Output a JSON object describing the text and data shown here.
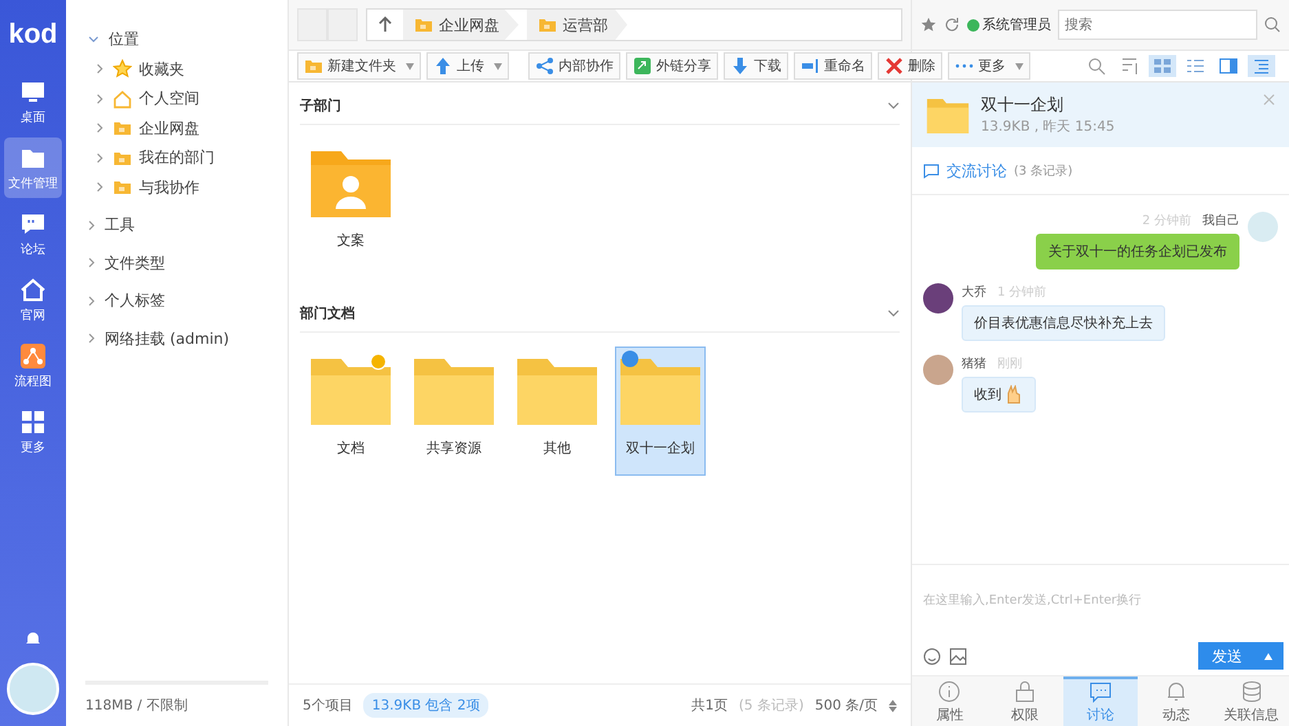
{
  "nav": {
    "logo": "kod",
    "items": [
      {
        "label": "桌面",
        "kind": "desktop",
        "selected": false
      },
      {
        "label": "文件管理",
        "kind": "folder",
        "selected": true
      },
      {
        "label": "论坛",
        "kind": "chat",
        "selected": false
      },
      {
        "label": "官网",
        "kind": "home",
        "selected": false
      },
      {
        "label": "流程图",
        "kind": "flow",
        "selected": false
      },
      {
        "label": "更多",
        "kind": "grid",
        "selected": false
      }
    ]
  },
  "tree": {
    "sections": [
      {
        "label": "位置",
        "expanded": true,
        "children": [
          {
            "label": "收藏夹",
            "kind": "star"
          },
          {
            "label": "个人空间",
            "kind": "house"
          },
          {
            "label": "企业网盘",
            "kind": "folder"
          },
          {
            "label": "我在的部门",
            "kind": "folder"
          },
          {
            "label": "与我协作",
            "kind": "folder"
          }
        ]
      },
      {
        "label": "工具",
        "expanded": false
      },
      {
        "label": "文件类型",
        "expanded": false
      },
      {
        "label": "个人标签",
        "expanded": false
      },
      {
        "label": "网络挂载 (admin)",
        "expanded": false
      }
    ],
    "storage": "118MB / 不限制"
  },
  "address": {
    "breadcrumbs": [
      "企业网盘",
      "运营部"
    ],
    "user": "系统管理员",
    "search": {
      "placeholder": "搜索"
    }
  },
  "toolbar": [
    {
      "label": "新建文件夹",
      "kind": "folder",
      "dropdown": true
    },
    {
      "label": "上传",
      "kind": "up",
      "dropdown": true
    },
    {
      "label": "内部协作",
      "kind": "share",
      "dropdown": false
    },
    {
      "label": "外链分享",
      "kind": "link",
      "dropdown": false
    },
    {
      "label": "下载",
      "kind": "down",
      "dropdown": false
    },
    {
      "label": "重命名",
      "kind": "rename",
      "dropdown": false
    },
    {
      "label": "删除",
      "kind": "delete",
      "dropdown": false
    },
    {
      "label": "更多",
      "kind": "more",
      "dropdown": true
    }
  ],
  "views": [
    {
      "kind": "zoom",
      "selected": false
    },
    {
      "kind": "sort",
      "selected": false
    },
    {
      "kind": "icons",
      "selected": true
    },
    {
      "kind": "list",
      "selected": false
    },
    {
      "kind": "split",
      "selected": false
    },
    {
      "kind": "panel",
      "selected": true
    }
  ],
  "sections": [
    {
      "title": "子部门",
      "items": [
        {
          "name": "文案",
          "kind": "person",
          "selected": false,
          "pinned": false
        }
      ]
    },
    {
      "title": "部门文档",
      "items": [
        {
          "name": "文档",
          "kind": "folder",
          "selected": false,
          "pinned": true
        },
        {
          "name": "共享资源",
          "kind": "folder",
          "selected": false,
          "pinned": false
        },
        {
          "name": "其他",
          "kind": "folder",
          "selected": false,
          "pinned": false
        },
        {
          "name": "双十一企划",
          "kind": "folder",
          "selected": true,
          "pinned": false
        }
      ]
    }
  ],
  "status_bar": {
    "count": "5个项目",
    "selection": "13.9KB 包含 2项",
    "pages": "共1页",
    "records": "(5 条记录)",
    "per_page": "500 条/页"
  },
  "detail": {
    "title": "双十一企划",
    "meta": "13.9KB , 昨天 15:45",
    "discussion": {
      "title": "交流讨论",
      "count": "(3 条记录)"
    },
    "messages": [
      {
        "author": "我自己",
        "time": "2 分钟前",
        "text": "关于双十一的任务企划已发布",
        "mine": true,
        "emoji": false
      },
      {
        "author": "大乔",
        "time": "1 分钟前",
        "text": "价目表优惠信息尽快补充上去",
        "mine": false,
        "emoji": false
      },
      {
        "author": "猪猪",
        "time": "刚刚",
        "text": "收到",
        "mine": false,
        "emoji": true
      }
    ],
    "input": {
      "placeholder": "在这里输入,Enter发送,Ctrl+Enter换行"
    },
    "send": "发送",
    "tabs": [
      {
        "label": "属性",
        "kind": "info",
        "selected": false
      },
      {
        "label": "权限",
        "kind": "lock",
        "selected": false
      },
      {
        "label": "讨论",
        "kind": "chat",
        "selected": true
      },
      {
        "label": "动态",
        "kind": "bell",
        "selected": false
      },
      {
        "label": "关联信息",
        "kind": "db",
        "selected": false
      }
    ]
  }
}
